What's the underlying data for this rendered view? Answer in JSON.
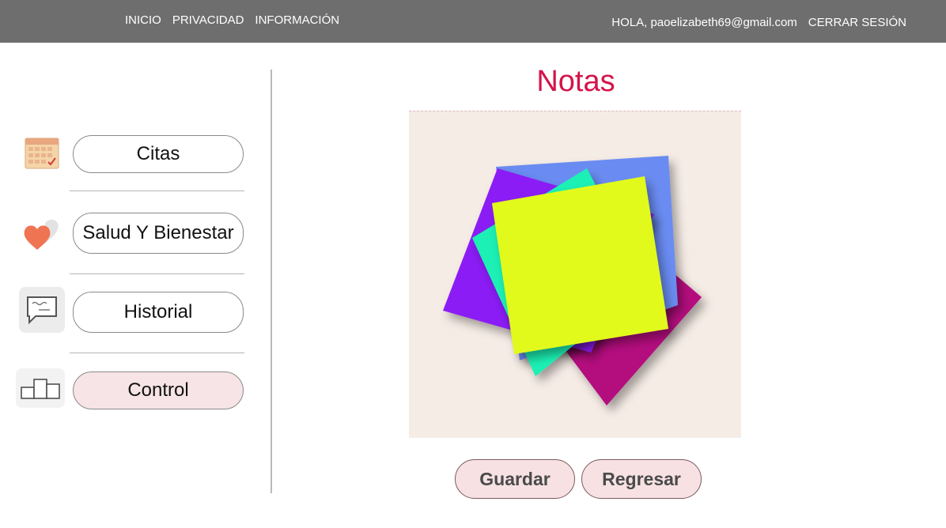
{
  "nav": {
    "inicio": "INICIO",
    "privacidad": "PRIVACIDAD",
    "informacion": "INFORMACIÓN",
    "greeting": "HOLA, paoelizabeth69@gmail.com",
    "logout": "CERRAR SESIÓN"
  },
  "sidebar": {
    "items": [
      {
        "label": "Citas",
        "icon": "calendar-icon"
      },
      {
        "label": "Salud Y Bienestar",
        "icon": "heart-icon"
      },
      {
        "label": "Historial",
        "icon": "chat-bubble-icon"
      },
      {
        "label": "Control",
        "icon": "podium-icon"
      }
    ]
  },
  "main": {
    "title": "Notas",
    "save_label": "Guardar",
    "back_label": "Regresar"
  },
  "colors": {
    "topbar": "#6e6e6e",
    "title": "#d4134a",
    "active_button": "#f7e4e6",
    "note_yellow": "#e1fa1e",
    "note_purple": "#8b1cf5",
    "note_blue": "#6b8cf2",
    "note_teal": "#1af0b4",
    "note_magenta": "#b4077e"
  }
}
